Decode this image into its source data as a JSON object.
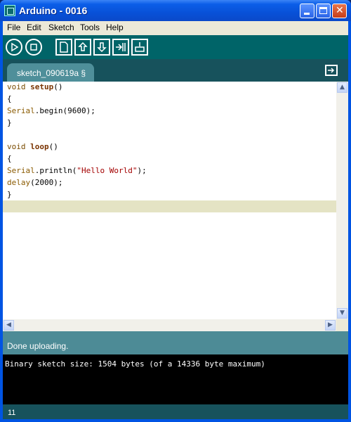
{
  "window": {
    "title": "Arduino - 0016"
  },
  "menu": {
    "items": [
      "File",
      "Edit",
      "Sketch",
      "Tools",
      "Help"
    ]
  },
  "toolbar": {
    "icons": [
      "play-icon",
      "stop-icon",
      "new-file-icon",
      "upload-arrow-icon",
      "download-arrow-icon",
      "upload-to-board-icon",
      "serial-monitor-icon"
    ]
  },
  "tabs": [
    {
      "label": "sketch_090619a §"
    }
  ],
  "editor": {
    "lines": [
      {
        "kw": "void ",
        "fn": "setup",
        "rest": "()"
      },
      {
        "plain": "{"
      },
      {
        "cls": "Serial",
        "rest": ".begin(9600);"
      },
      {
        "plain": "}"
      },
      {
        "plain": ""
      },
      {
        "kw": "void ",
        "fn": "loop",
        "rest": "()"
      },
      {
        "plain": "{"
      },
      {
        "cls": "Serial",
        "rest": ".println(",
        "str": "\"Hello World\"",
        "tail": ");"
      },
      {
        "cls": "delay",
        "rest": "(2000);"
      },
      {
        "plain": "}"
      }
    ]
  },
  "status": {
    "message": "Done uploading."
  },
  "console": {
    "text": "Binary sketch size: 1504 bytes (of a 14336 byte maximum)"
  },
  "footer": {
    "line_number": "11"
  },
  "colors": {
    "toolbar": "#006468",
    "tabrow": "#17525c",
    "status": "#4d8b96",
    "current_line": "#e4e3c4"
  }
}
